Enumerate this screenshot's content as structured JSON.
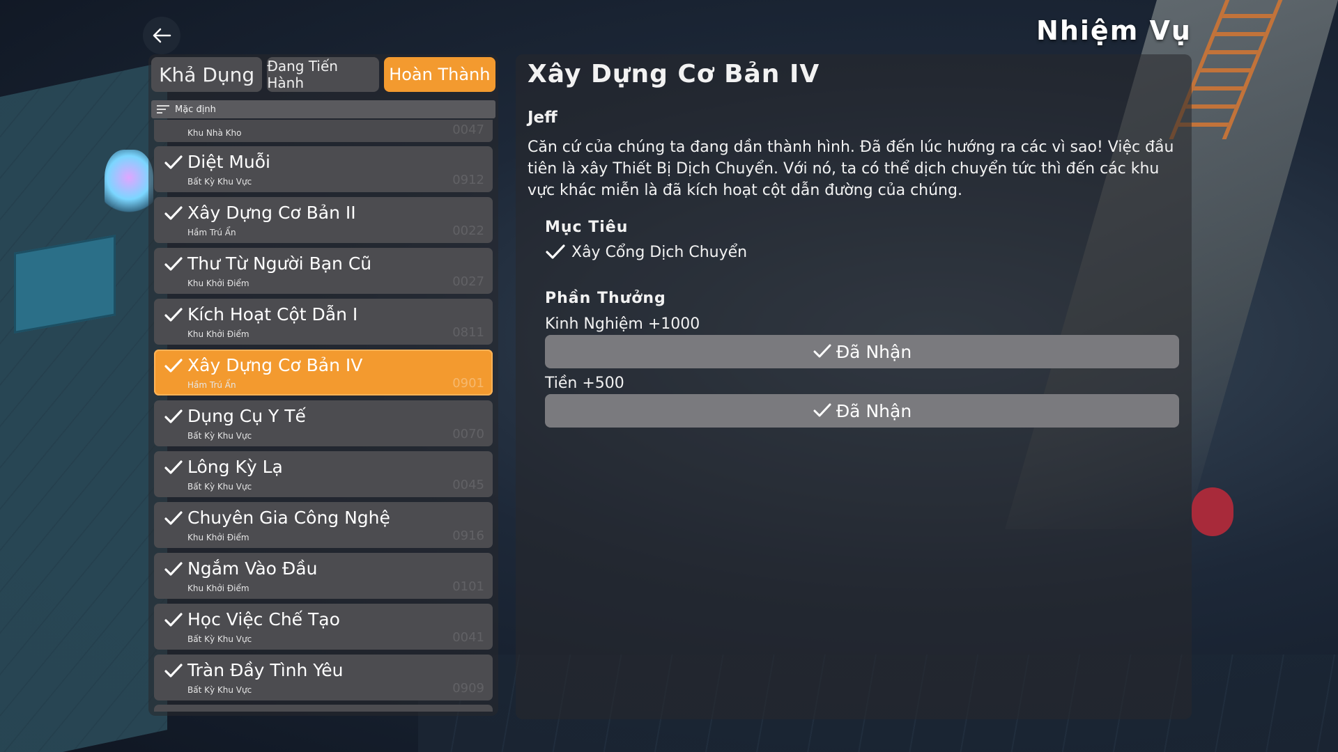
{
  "header": {
    "title": "Nhiệm Vụ"
  },
  "tabs": [
    {
      "label": "Khả Dụng"
    },
    {
      "label": "Đang Tiến Hành"
    },
    {
      "label": "Hoàn Thành"
    }
  ],
  "sort": {
    "label": "Mặc định"
  },
  "quest_list": {
    "partial_top": {
      "subtitle": "Khu Nhà Kho",
      "number": "0047"
    },
    "items": [
      {
        "title": "Diệt Muỗi",
        "subtitle": "Bất Kỳ Khu Vực",
        "number": "0912"
      },
      {
        "title": "Xây Dựng Cơ Bản II",
        "subtitle": "Hầm Trú Ẩn",
        "number": "0022"
      },
      {
        "title": "Thư Từ Người Bạn Cũ",
        "subtitle": "Khu Khởi Điểm",
        "number": "0027"
      },
      {
        "title": "Kích Hoạt Cột Dẫn I",
        "subtitle": "Khu Khởi Điểm",
        "number": "0811"
      },
      {
        "title": "Xây Dựng Cơ Bản IV",
        "subtitle": "Hầm Trú Ẩn",
        "number": "0901"
      },
      {
        "title": "Dụng Cụ Y Tế",
        "subtitle": "Bất Kỳ Khu Vực",
        "number": "0070"
      },
      {
        "title": "Lông Kỳ Lạ",
        "subtitle": "Bất Kỳ Khu Vực",
        "number": "0045"
      },
      {
        "title": "Chuyên Gia Công Nghệ",
        "subtitle": "Khu Khởi Điểm",
        "number": "0916"
      },
      {
        "title": "Ngắm Vào Đầu",
        "subtitle": "Khu Khởi Điểm",
        "number": "0101"
      },
      {
        "title": "Học Việc Chế Tạo",
        "subtitle": "Bất Kỳ Khu Vực",
        "number": "0041"
      },
      {
        "title": "Tràn Đầy Tình Yêu",
        "subtitle": "Bất Kỳ Khu Vực",
        "number": "0909"
      }
    ],
    "selected_index": 4
  },
  "detail": {
    "title": "Xây Dựng Cơ Bản IV",
    "giver": "Jeff",
    "description": "Căn cứ của chúng ta đang dần thành hình. Đã đến lúc hướng ra các vì sao! Việc đầu tiên là xây Thiết Bị Dịch Chuyển. Với nó, ta có thể dịch chuyển tức thì đến các khu vực khác miễn là đã kích hoạt cột dẫn đường của chúng.",
    "objective_heading": "Mục Tiêu",
    "objective": "Xây Cổng Dịch Chuyển",
    "rewards_heading": "Phần Thưởng",
    "rewards": [
      {
        "label": "Kinh Nghiệm +1000",
        "button": "Đã Nhận"
      },
      {
        "label": "Tiền +500",
        "button": "Đã Nhận"
      }
    ]
  },
  "colors": {
    "accent": "#f39a2f",
    "row_bg": "#4c4c50",
    "claimed_button": "#7a7a7e"
  }
}
